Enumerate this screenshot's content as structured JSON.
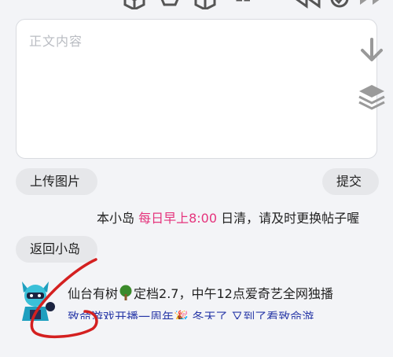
{
  "editor": {
    "placeholder": "正文内容"
  },
  "buttons": {
    "upload": "上传图片",
    "submit": "提交",
    "back": "返回小岛"
  },
  "notice": {
    "prefix": "本小岛 ",
    "highlight": "每日早上8:00",
    "suffix": " 日清，请及时更换帖子喔"
  },
  "post": {
    "line1_a": "仙台有树",
    "line1_b": "定档2.7，中午12点爱奇艺全网独播",
    "line2": "致命游戏开播一周年🎉   冬天了   又到了看致命游"
  },
  "icons": {
    "top": [
      "cube-icon",
      "crown-icon",
      "box-icon",
      "quote-icon",
      "rewind-icon",
      "check-icon",
      "fast-forward-icon"
    ],
    "side": [
      "arrow-down-icon",
      "layers-icon"
    ],
    "inline": [
      "tree-icon"
    ]
  },
  "colors": {
    "highlight": "#e5337c",
    "link": "#2a3aa8",
    "scribble": "#d42020"
  }
}
